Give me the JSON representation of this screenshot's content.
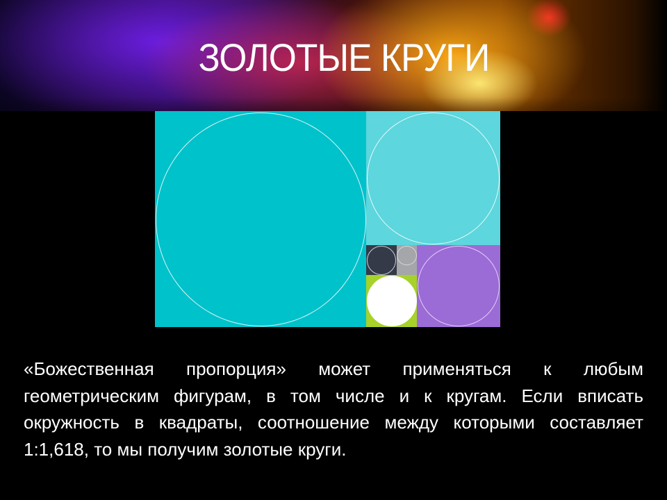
{
  "slide": {
    "title": "ЗОЛОТЫЕ КРУГИ",
    "body": "«Божественная пропорция» может применяться к любым геометрическим фигурам, в том числе и к кругам. Если вписать окружность в квадраты, соотношение между которыми составляет 1:1,618, то мы получим золотые круги."
  },
  "figure": {
    "colors": {
      "large": "#00c2cb",
      "medium": "#5dd6dd",
      "purple": "#9b6bd6",
      "dark": "#353a48",
      "gray": "#a4a6aa",
      "green": "#a6d22a",
      "white_circle": "#ffffff"
    }
  }
}
